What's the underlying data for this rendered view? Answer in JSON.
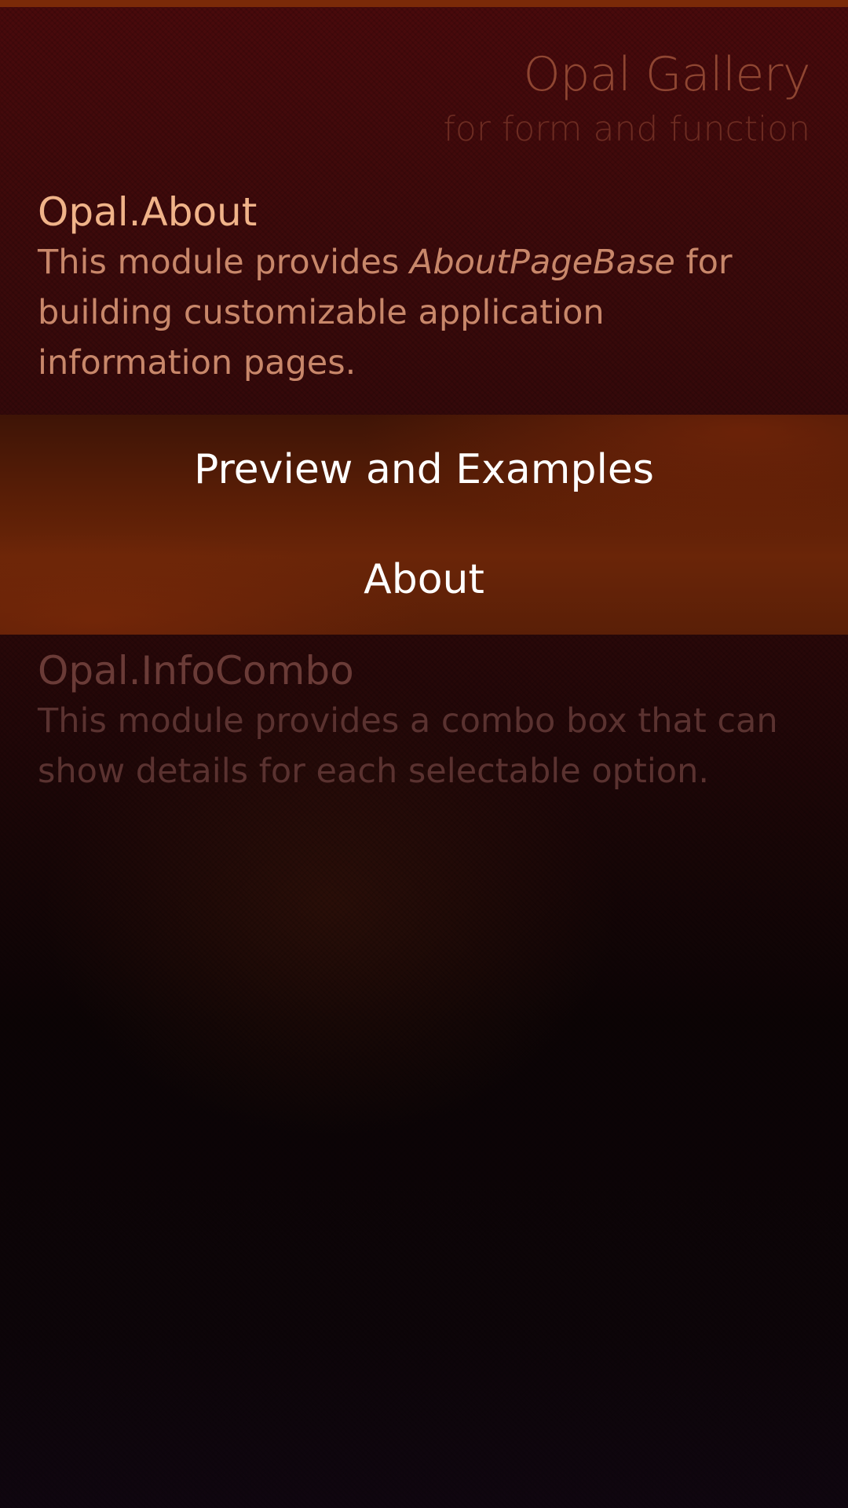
{
  "header": {
    "title": "Opal Gallery",
    "subtitle": "for form and function"
  },
  "items": [
    {
      "title": "Opal.About",
      "desc_prefix": "This module provides ",
      "desc_emphasis": "AboutPageBase",
      "desc_suffix": " for building customizable application information pages."
    },
    {
      "title": "Opal.InfoCombo",
      "desc": "This module provides a combo box that can show details for each selectable option."
    }
  ],
  "context_menu": {
    "items": [
      {
        "label": "Preview and Examples"
      },
      {
        "label": "About"
      }
    ]
  },
  "colors": {
    "accent": "#7b2a08",
    "highlight_text": "#f0b389",
    "secondary_text": "#c8876a",
    "menu_text": "#ffffff"
  }
}
